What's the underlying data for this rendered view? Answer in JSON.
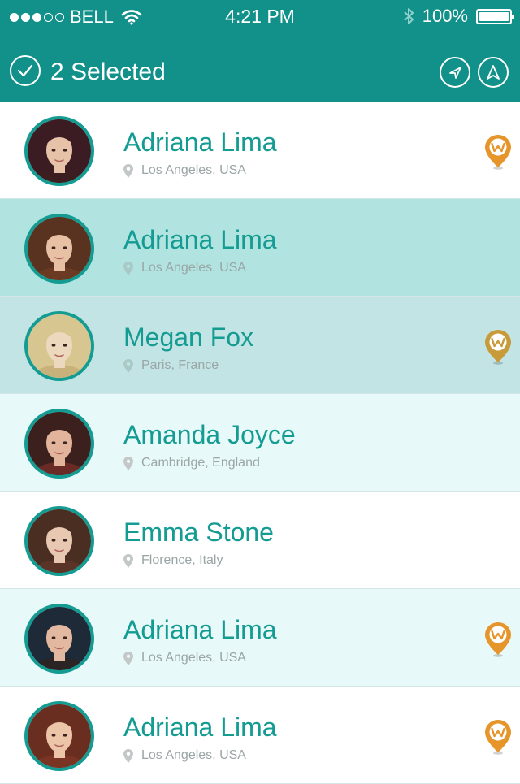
{
  "status_bar": {
    "carrier": "BELL",
    "time": "4:21 PM",
    "battery": "100%",
    "signal_bars": [
      true,
      true,
      true,
      false,
      false
    ]
  },
  "header": {
    "selection_title": "2 Selected",
    "left_icon": "check-circle-icon",
    "right_icons": [
      "navigate-arrow-icon",
      "send-icon"
    ]
  },
  "contacts": [
    {
      "name": "Adriana Lima",
      "location": "Los Angeles, USA",
      "selected": false,
      "has_badge": true,
      "badge_color": "#e6952a",
      "row_color": "#ffffff",
      "avatar_colors": [
        "#3a1c22",
        "#e6c2a8",
        "#3d1e20"
      ]
    },
    {
      "name": "Adriana Lima",
      "location": "Los Angeles, USA",
      "selected": true,
      "has_badge": false,
      "badge_color": "",
      "row_color": "#b1e3e0",
      "avatar_colors": [
        "#5a3220",
        "#e8c0a4",
        "#6b3a22"
      ]
    },
    {
      "name": "Megan Fox",
      "location": "Paris, France",
      "selected": true,
      "has_badge": true,
      "badge_color": "#c89b3a",
      "row_color": "#c3e4e4",
      "avatar_colors": [
        "#d8c690",
        "#ecd8bc",
        "#c9b27a"
      ]
    },
    {
      "name": "Amanda Joyce",
      "location": "Cambridge, England",
      "selected": false,
      "has_badge": false,
      "badge_color": "",
      "row_color": "#e7f9f8",
      "avatar_colors": [
        "#3c201e",
        "#e2b49c",
        "#6a2a26"
      ]
    },
    {
      "name": "Emma Stone",
      "location": "Florence, Italy",
      "selected": false,
      "has_badge": false,
      "badge_color": "",
      "row_color": "#ffffff",
      "avatar_colors": [
        "#4a2e22",
        "#e8c8b0",
        "#5a3426"
      ]
    },
    {
      "name": "Adriana Lima",
      "location": "Los Angeles, USA",
      "selected": false,
      "has_badge": true,
      "badge_color": "#e6952a",
      "row_color": "#e7f9f8",
      "avatar_colors": [
        "#1e2a38",
        "#e2b8a0",
        "#2a2424"
      ]
    },
    {
      "name": "Adriana Lima",
      "location": "Los Angeles, USA",
      "selected": false,
      "has_badge": true,
      "badge_color": "#e6952a",
      "row_color": "#ffffff",
      "avatar_colors": [
        "#6a2e20",
        "#ecc4a8",
        "#7a3424"
      ]
    }
  ],
  "colors": {
    "header_bg": "#12908a",
    "accent": "#149c93",
    "secondary_text": "#9aa5a5"
  }
}
